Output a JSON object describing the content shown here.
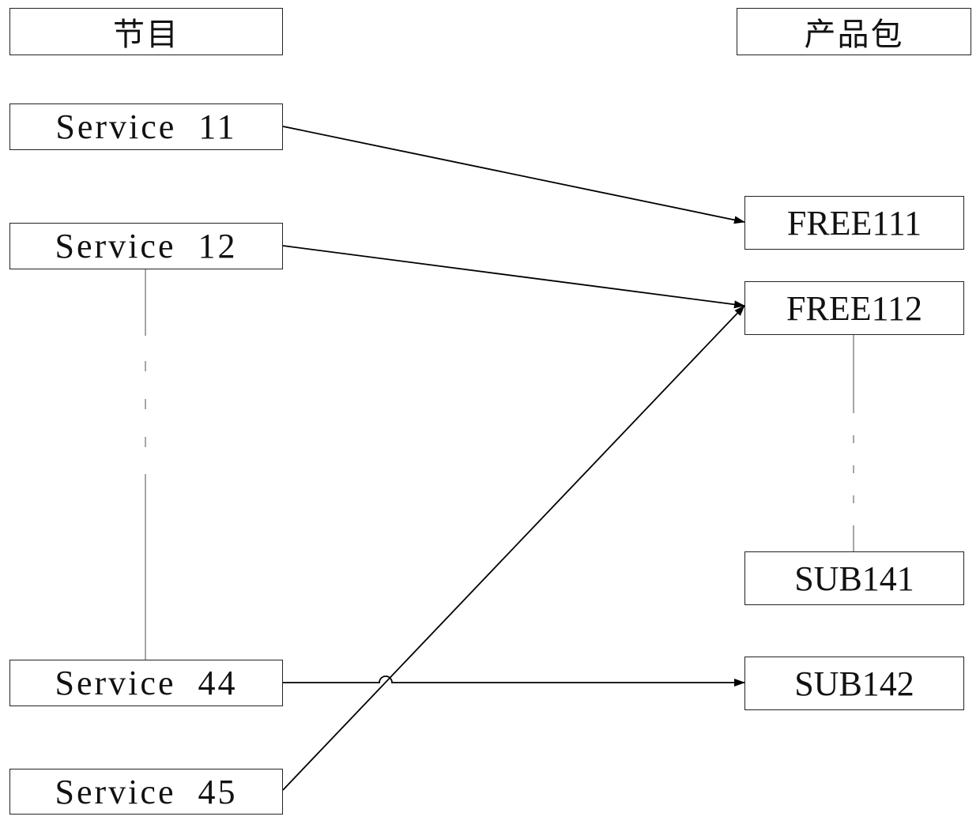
{
  "headers": {
    "programs": "节目",
    "packages": "产品包"
  },
  "services": [
    {
      "id": "s11",
      "label": "Service 11"
    },
    {
      "id": "s12",
      "label": "Service 12"
    },
    {
      "id": "s44",
      "label": "Service 44"
    },
    {
      "id": "s45",
      "label": "Service 45"
    }
  ],
  "packages": [
    {
      "id": "p111",
      "label": "FREE111"
    },
    {
      "id": "p112",
      "label": "FREE112"
    },
    {
      "id": "p141",
      "label": "SUB141"
    },
    {
      "id": "p142",
      "label": "SUB142"
    }
  ],
  "connections": [
    {
      "from": "Service 11",
      "to": "FREE111"
    },
    {
      "from": "Service 12",
      "to": "FREE112"
    },
    {
      "from": "Service 44",
      "to": "SUB142"
    },
    {
      "from": "Service 45",
      "to": "FREE112"
    }
  ],
  "ellipsis_links": [
    {
      "from": "Service 12",
      "to": "Service 44",
      "style": "dash-dot"
    },
    {
      "from": "FREE112",
      "to": "SUB141",
      "style": "dash-dot"
    }
  ]
}
